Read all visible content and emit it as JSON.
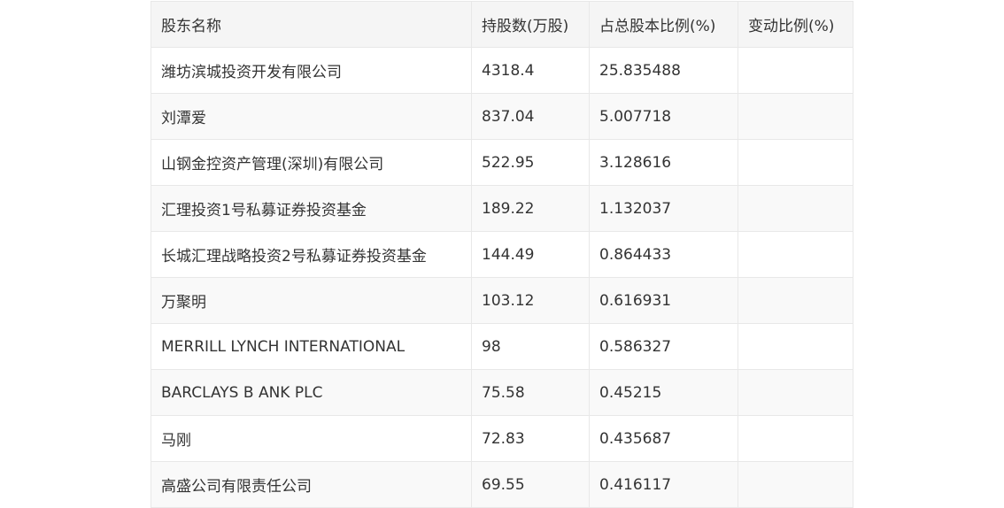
{
  "table": {
    "headers": [
      "股东名称",
      "持股数(万股)",
      "占总股本比例(%)",
      "变动比例(%)"
    ],
    "rows": [
      [
        "潍坊滨城投资开发有限公司",
        "4318.4",
        "25.835488",
        ""
      ],
      [
        "刘潭爱",
        "837.04",
        "5.007718",
        ""
      ],
      [
        "山钢金控资产管理(深圳)有限公司",
        "522.95",
        "3.128616",
        ""
      ],
      [
        "汇理投资1号私募证券投资基金",
        "189.22",
        "1.132037",
        ""
      ],
      [
        "长城汇理战略投资2号私募证券投资基金",
        "144.49",
        "0.864433",
        ""
      ],
      [
        "万聚明",
        "103.12",
        "0.616931",
        ""
      ],
      [
        "MERRILL LYNCH INTERNATIONAL",
        "98",
        "0.586327",
        ""
      ],
      [
        "BARCLAYS B ANK PLC",
        "75.58",
        "0.45215",
        ""
      ],
      [
        "马刚",
        "72.83",
        "0.435687",
        ""
      ],
      [
        "高盛公司有限责任公司",
        "69.55",
        "0.416117",
        ""
      ]
    ]
  }
}
